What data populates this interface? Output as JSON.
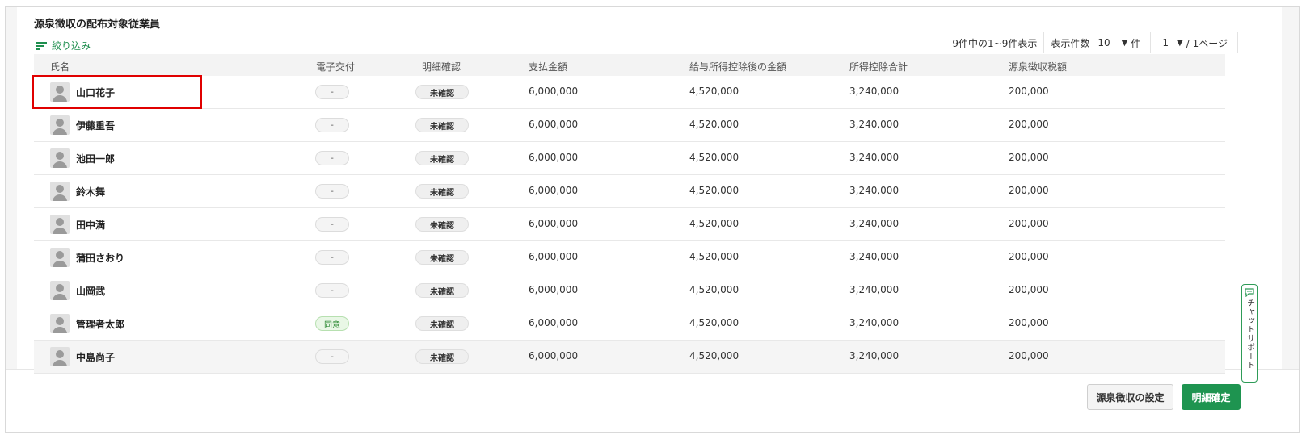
{
  "title": "源泉徴収の配布対象従業員",
  "filter_label": "絞り込み",
  "pager": {
    "count_text": "9件中の1~9件表示",
    "per_page_label": "表示件数",
    "per_page_value": "10",
    "per_page_unit": "件",
    "page_value": "1",
    "pages_total": "/ 1ページ"
  },
  "columns": [
    "氏名",
    "電子交付",
    "明細確認",
    "支払金額",
    "給与所得控除後の金額",
    "所得控除合計",
    "源泉徴収税額"
  ],
  "rows": [
    {
      "name": "山口花子",
      "e_delivery": "-",
      "confirm": "未確認",
      "payment": "6,000,000",
      "after_deduction": "4,520,000",
      "deduction_total": "3,240,000",
      "withholding": "200,000"
    },
    {
      "name": "伊藤重吾",
      "e_delivery": "-",
      "confirm": "未確認",
      "payment": "6,000,000",
      "after_deduction": "4,520,000",
      "deduction_total": "3,240,000",
      "withholding": "200,000"
    },
    {
      "name": "池田一郎",
      "e_delivery": "-",
      "confirm": "未確認",
      "payment": "6,000,000",
      "after_deduction": "4,520,000",
      "deduction_total": "3,240,000",
      "withholding": "200,000"
    },
    {
      "name": "鈴木舞",
      "e_delivery": "-",
      "confirm": "未確認",
      "payment": "6,000,000",
      "after_deduction": "4,520,000",
      "deduction_total": "3,240,000",
      "withholding": "200,000"
    },
    {
      "name": "田中満",
      "e_delivery": "-",
      "confirm": "未確認",
      "payment": "6,000,000",
      "after_deduction": "4,520,000",
      "deduction_total": "3,240,000",
      "withholding": "200,000"
    },
    {
      "name": "蒲田さおり",
      "e_delivery": "-",
      "confirm": "未確認",
      "payment": "6,000,000",
      "after_deduction": "4,520,000",
      "deduction_total": "3,240,000",
      "withholding": "200,000"
    },
    {
      "name": "山岡武",
      "e_delivery": "-",
      "confirm": "未確認",
      "payment": "6,000,000",
      "after_deduction": "4,520,000",
      "deduction_total": "3,240,000",
      "withholding": "200,000"
    },
    {
      "name": "管理者太郎",
      "e_delivery": "同意",
      "confirm": "未確認",
      "payment": "6,000,000",
      "after_deduction": "4,520,000",
      "deduction_total": "3,240,000",
      "withholding": "200,000"
    },
    {
      "name": "中島尚子",
      "e_delivery": "-",
      "confirm": "未確認",
      "payment": "6,000,000",
      "after_deduction": "4,520,000",
      "deduction_total": "3,240,000",
      "withholding": "200,000"
    }
  ],
  "chat_support_label": "チャットサポート",
  "buttons": {
    "settings": "源泉徴収の設定",
    "confirm": "明細確定"
  },
  "colors": {
    "accent_green": "#1e9450",
    "highlight_red": "#e00000"
  },
  "icons": {
    "filter": "filter-lines-icon",
    "avatar": "person-icon",
    "dropdown": "triangle-down-icon",
    "chat": "speech-bubble-icon"
  }
}
